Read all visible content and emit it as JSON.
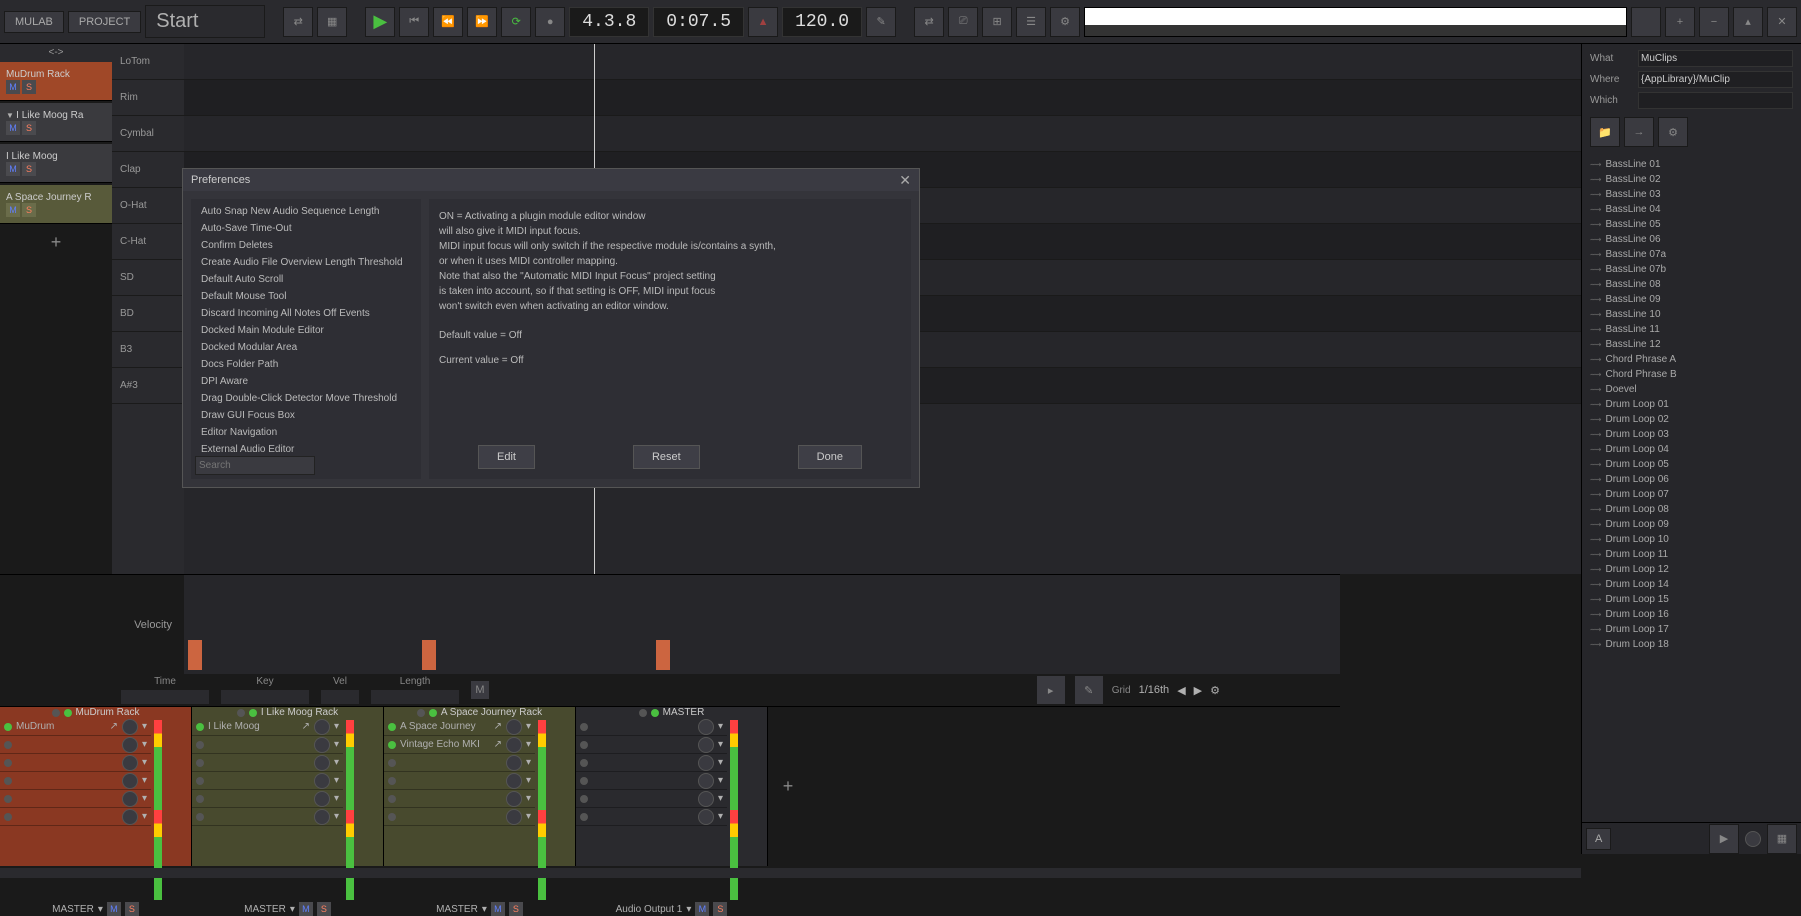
{
  "toolbar": {
    "app": "MULAB",
    "project": "PROJECT",
    "title": "Start",
    "position": "4.3.8",
    "time": "0:07.5",
    "tempo": "120.0"
  },
  "tracks": [
    {
      "name": "MuDrum Rack",
      "style": "orange"
    },
    {
      "name": "I Like Moog Ra",
      "style": "dark",
      "expand": true
    },
    {
      "name": "I Like Moog",
      "style": "dark"
    },
    {
      "name": "A Space Journey R",
      "style": "olive"
    }
  ],
  "rows": [
    "LoTom",
    "Rim",
    "Cymbal",
    "Clap",
    "O-Hat",
    "C-Hat",
    "SD",
    "BD",
    "B3",
    "A#3"
  ],
  "velocity_label": "Velocity",
  "params": {
    "time": "Time",
    "key": "Key",
    "vel": "Vel",
    "length": "Length",
    "m": "M",
    "grid": "Grid",
    "grid_val": "1/16th"
  },
  "mixer": [
    {
      "name": "MuDrum Rack",
      "style": "orange",
      "inserts": [
        "MuDrum"
      ],
      "out": "MASTER"
    },
    {
      "name": "I Like Moog Rack",
      "style": "olive",
      "inserts": [
        "I Like Moog"
      ],
      "out": "MASTER"
    },
    {
      "name": "A Space Journey Rack",
      "style": "olive",
      "inserts": [
        "A Space Journey",
        "Vintage Echo MKI"
      ],
      "out": "MASTER"
    },
    {
      "name": "MASTER",
      "style": "dark",
      "inserts": [],
      "out": "Audio Output 1"
    }
  ],
  "browser": {
    "what_label": "What",
    "what": "MuClips",
    "where_label": "Where",
    "where": "{AppLibrary}/MuClip",
    "which_label": "Which",
    "which": "",
    "items": [
      "BassLine 01",
      "BassLine 02",
      "BassLine 03",
      "BassLine 04",
      "BassLine 05",
      "BassLine 06",
      "BassLine 07a",
      "BassLine 07b",
      "BassLine 08",
      "BassLine 09",
      "BassLine 10",
      "BassLine 11",
      "BassLine 12",
      "Chord Phrase A",
      "Chord Phrase B",
      "Doevel",
      "Drum Loop 01",
      "Drum Loop 02",
      "Drum Loop 03",
      "Drum Loop 04",
      "Drum Loop 05",
      "Drum Loop 06",
      "Drum Loop 07",
      "Drum Loop 08",
      "Drum Loop 09",
      "Drum Loop 10",
      "Drum Loop 11",
      "Drum Loop 12",
      "Drum Loop 14",
      "Drum Loop 15",
      "Drum Loop 16",
      "Drum Loop 17",
      "Drum Loop 18"
    ],
    "a_btn": "A"
  },
  "dialog": {
    "title": "Preferences",
    "items": [
      "Auto Snap New Audio Sequence Length",
      "Auto-Save Time-Out",
      "Confirm Deletes",
      "Create Audio File Overview Length Threshold",
      "Default Auto Scroll",
      "Default Mouse Tool",
      "Discard Incoming All Notes Off Events",
      "Docked Main Module Editor",
      "Docked Modular Area",
      "Docs Folder Path",
      "DPI Aware",
      "Drag Double-Click Detector Move Threshold",
      "Draw GUI Focus Box",
      "Editor Navigation",
      "External Audio Editor"
    ],
    "search_placeholder": "Search",
    "description": "ON = Activating a plugin module editor window\nwill also give it MIDI input focus.\nMIDI input focus will only switch if the respective module is/contains a synth,\nor when it uses MIDI controller mapping.\nNote that also the \"Automatic MIDI Input Focus\" project setting\nis taken into account, so if that setting is OFF, MIDI input focus\nwon't switch even when activating an editor window.",
    "default_val": "Default value = Off",
    "current_val": "Current value = Off",
    "edit": "Edit",
    "reset": "Reset",
    "done": "Done"
  }
}
